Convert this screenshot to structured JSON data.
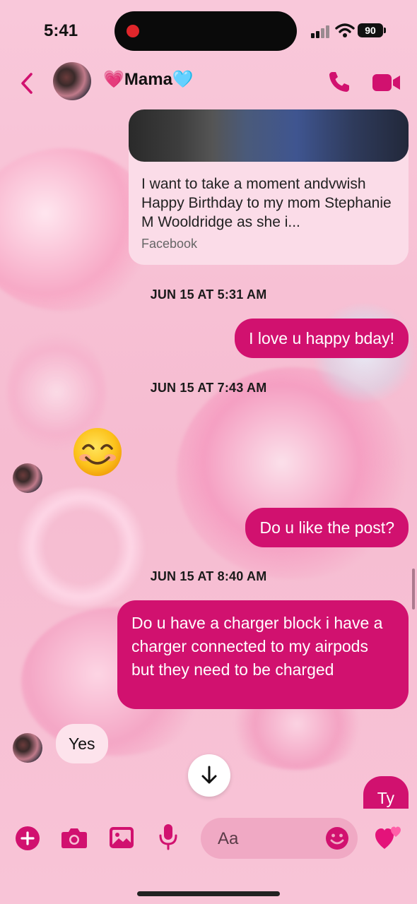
{
  "status_bar": {
    "time": "5:41",
    "battery": "90"
  },
  "header": {
    "contact_name": "💗Mama🩵"
  },
  "link_preview": {
    "text": "I want to take a moment andvwish Happy Birthday to my mom Stephanie M Wooldridge as she i...",
    "source": "Facebook"
  },
  "messages": {
    "ts1": "JUN 15 AT 5:31 AM",
    "m1": "I love u happy bday!",
    "ts2": "JUN 15 AT 7:43 AM",
    "m2_emoji": "smiling-face-emoji",
    "m3": "Do u like the post?",
    "ts3": "JUN 15 AT 8:40 AM",
    "m4": "Do u have a charger block i have a charger connected to my airpods but they need to be charged",
    "m5": "Yes",
    "m6": "Ty"
  },
  "composer": {
    "placeholder": "Aa"
  },
  "colors": {
    "accent": "#d1116f",
    "background": "#f7bfd3",
    "incoming_bubble": "#fde3ec"
  }
}
